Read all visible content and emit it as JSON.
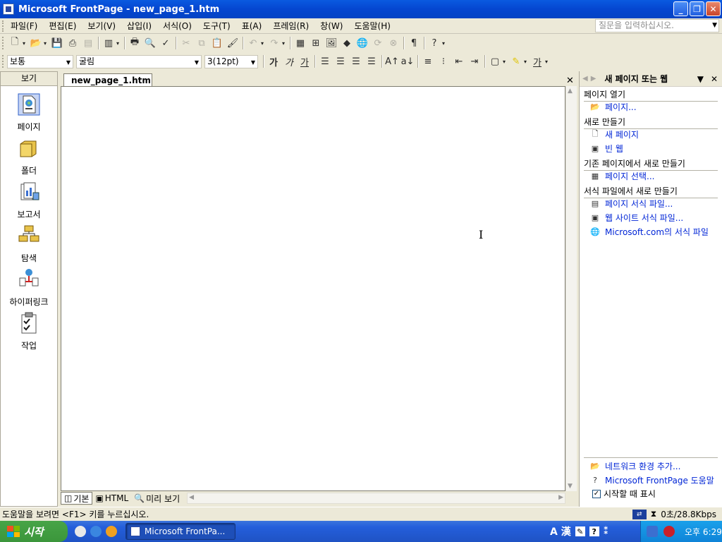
{
  "window": {
    "title": "Microsoft FrontPage - new_page_1.htm"
  },
  "menu": {
    "items": [
      "파일(F)",
      "편집(E)",
      "보기(V)",
      "삽입(I)",
      "서식(O)",
      "도구(T)",
      "표(A)",
      "프레임(R)",
      "창(W)",
      "도움말(H)"
    ],
    "ask_placeholder": "질문을 입력하십시오."
  },
  "format": {
    "style": "보통",
    "font": "굴림",
    "size": "3(12pt)"
  },
  "views": {
    "header": "보기",
    "items": [
      "페이지",
      "폴더",
      "보고서",
      "탐색",
      "하이퍼링크",
      "작업"
    ]
  },
  "document": {
    "tab": "new_page_1.htm"
  },
  "viewtabs": {
    "normal": "기본",
    "html": "HTML",
    "preview": "미리 보기"
  },
  "taskpane": {
    "title": "새 페이지 또는 웹",
    "sections": [
      {
        "label": "페이지 열기",
        "links": [
          "페이지..."
        ]
      },
      {
        "label": "새로 만들기",
        "links": [
          "새 페이지",
          "빈 웹"
        ]
      },
      {
        "label": "기존 페이지에서 새로 만들기",
        "links": [
          "페이지 선택..."
        ]
      },
      {
        "label": "서식 파일에서 새로 만들기",
        "links": [
          "페이지 서식 파일...",
          "웹 사이트 서식 파일...",
          "Microsoft.com의 서식 파일"
        ]
      }
    ],
    "bottom_links": [
      "네트워크 환경 추가...",
      "Microsoft FrontPage 도움말"
    ],
    "startup_check": "시작할 때 표시"
  },
  "status": {
    "message": "도움말을 보려면 <F1> 키를 누르십시오.",
    "speed": "0초/28.8Kbps"
  },
  "taskbar": {
    "start": "시작",
    "task_button": "Microsoft FrontPa...",
    "clock": "오후 6:29",
    "ime": "A 漢"
  }
}
